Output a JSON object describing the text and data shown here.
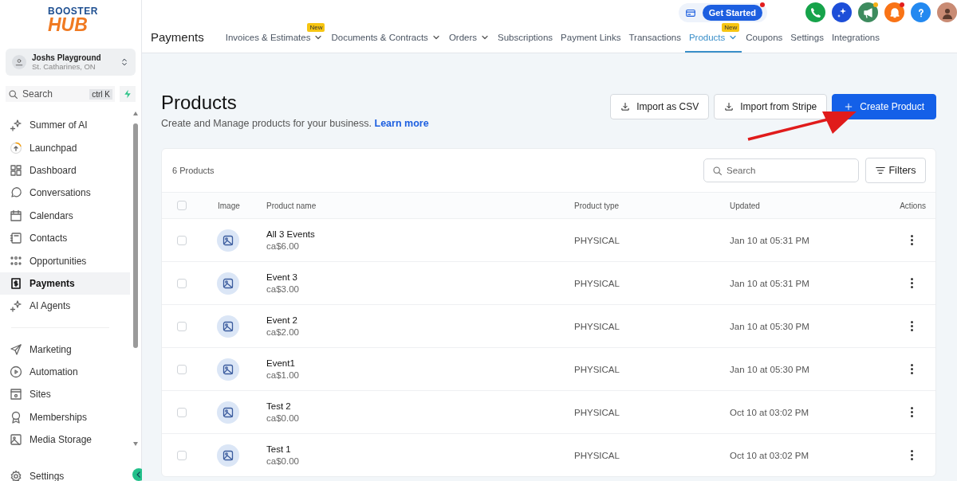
{
  "sidebar": {
    "logo": {
      "top": "BOOSTER",
      "bottom": "HUB"
    },
    "account": {
      "name": "Joshs Playground",
      "location": "St. Catharines, ON"
    },
    "search": {
      "placeholder": "Search",
      "shortcut": "ctrl K"
    },
    "nav_groups": [
      [
        {
          "label": "Summer of AI",
          "selected": false
        },
        {
          "label": "Launchpad",
          "selected": false
        },
        {
          "label": "Dashboard",
          "selected": false
        },
        {
          "label": "Conversations",
          "selected": false
        },
        {
          "label": "Calendars",
          "selected": false
        },
        {
          "label": "Contacts",
          "selected": false
        },
        {
          "label": "Opportunities",
          "selected": false
        },
        {
          "label": "Payments",
          "selected": true
        },
        {
          "label": "AI Agents",
          "selected": false
        }
      ],
      [
        {
          "label": "Marketing",
          "selected": false
        },
        {
          "label": "Automation",
          "selected": false
        },
        {
          "label": "Sites",
          "selected": false
        },
        {
          "label": "Memberships",
          "selected": false
        },
        {
          "label": "Media Storage",
          "selected": false
        }
      ]
    ],
    "settings": "Settings"
  },
  "header": {
    "title": "Payments",
    "get_started": {
      "label": "Get Started",
      "dot": true
    },
    "toolbar": [
      {
        "kind": "phone",
        "dot": false
      },
      {
        "kind": "sparkle",
        "dot": false
      },
      {
        "kind": "megaphone",
        "dot": true
      },
      {
        "kind": "bell",
        "dot": true
      },
      {
        "kind": "help",
        "dot": false
      },
      {
        "kind": "avatar",
        "dot": false
      }
    ],
    "tabs": [
      {
        "label": "Invoices & Estimates",
        "dropdown": true,
        "badge": "New",
        "selected": false
      },
      {
        "label": "Documents & Contracts",
        "dropdown": true,
        "selected": false
      },
      {
        "label": "Orders",
        "dropdown": true,
        "selected": false
      },
      {
        "label": "Subscriptions",
        "dropdown": false,
        "selected": false
      },
      {
        "label": "Payment Links",
        "dropdown": false,
        "selected": false
      },
      {
        "label": "Transactions",
        "dropdown": false,
        "selected": false
      },
      {
        "label": "Products",
        "dropdown": true,
        "badge": "New",
        "selected": true
      },
      {
        "label": "Coupons",
        "dropdown": false,
        "selected": false
      },
      {
        "label": "Settings",
        "dropdown": false,
        "selected": false
      },
      {
        "label": "Integrations",
        "dropdown": false,
        "selected": false
      }
    ]
  },
  "page": {
    "title": "Products",
    "subtitle": "Create and Manage products for your business.",
    "link": "Learn more",
    "buttons": [
      {
        "label": "Import as CSV",
        "kind": "outline"
      },
      {
        "label": "Import from Stripe",
        "kind": "outline"
      },
      {
        "label": "Create Product",
        "kind": "primary"
      }
    ]
  },
  "table": {
    "all_checked": false,
    "count": "6 Products",
    "search": {
      "placeholder": "Search"
    },
    "filters": "Filters",
    "columns": [
      "Image",
      "Product name",
      "Product type",
      "Updated",
      "Actions"
    ],
    "rows": [
      {
        "name": "All 3 Events",
        "price": "ca$6.00",
        "type": "PHYSICAL",
        "updated": "Jan 10 at 05:31 PM",
        "checked": false
      },
      {
        "name": "Event 3",
        "price": "ca$3.00",
        "type": "PHYSICAL",
        "updated": "Jan 10 at 05:31 PM",
        "checked": false
      },
      {
        "name": "Event 2",
        "price": "ca$2.00",
        "type": "PHYSICAL",
        "updated": "Jan 10 at 05:30 PM",
        "checked": false
      },
      {
        "name": "Event1",
        "price": "ca$1.00",
        "type": "PHYSICAL",
        "updated": "Jan 10 at 05:30 PM",
        "checked": false
      },
      {
        "name": "Test 2",
        "price": "ca$0.00",
        "type": "PHYSICAL",
        "updated": "Oct 10 at 03:02 PM",
        "checked": false
      },
      {
        "name": "Test 1",
        "price": "ca$0.00",
        "type": "PHYSICAL",
        "updated": "Oct 10 at 03:02 PM",
        "checked": false
      }
    ]
  }
}
